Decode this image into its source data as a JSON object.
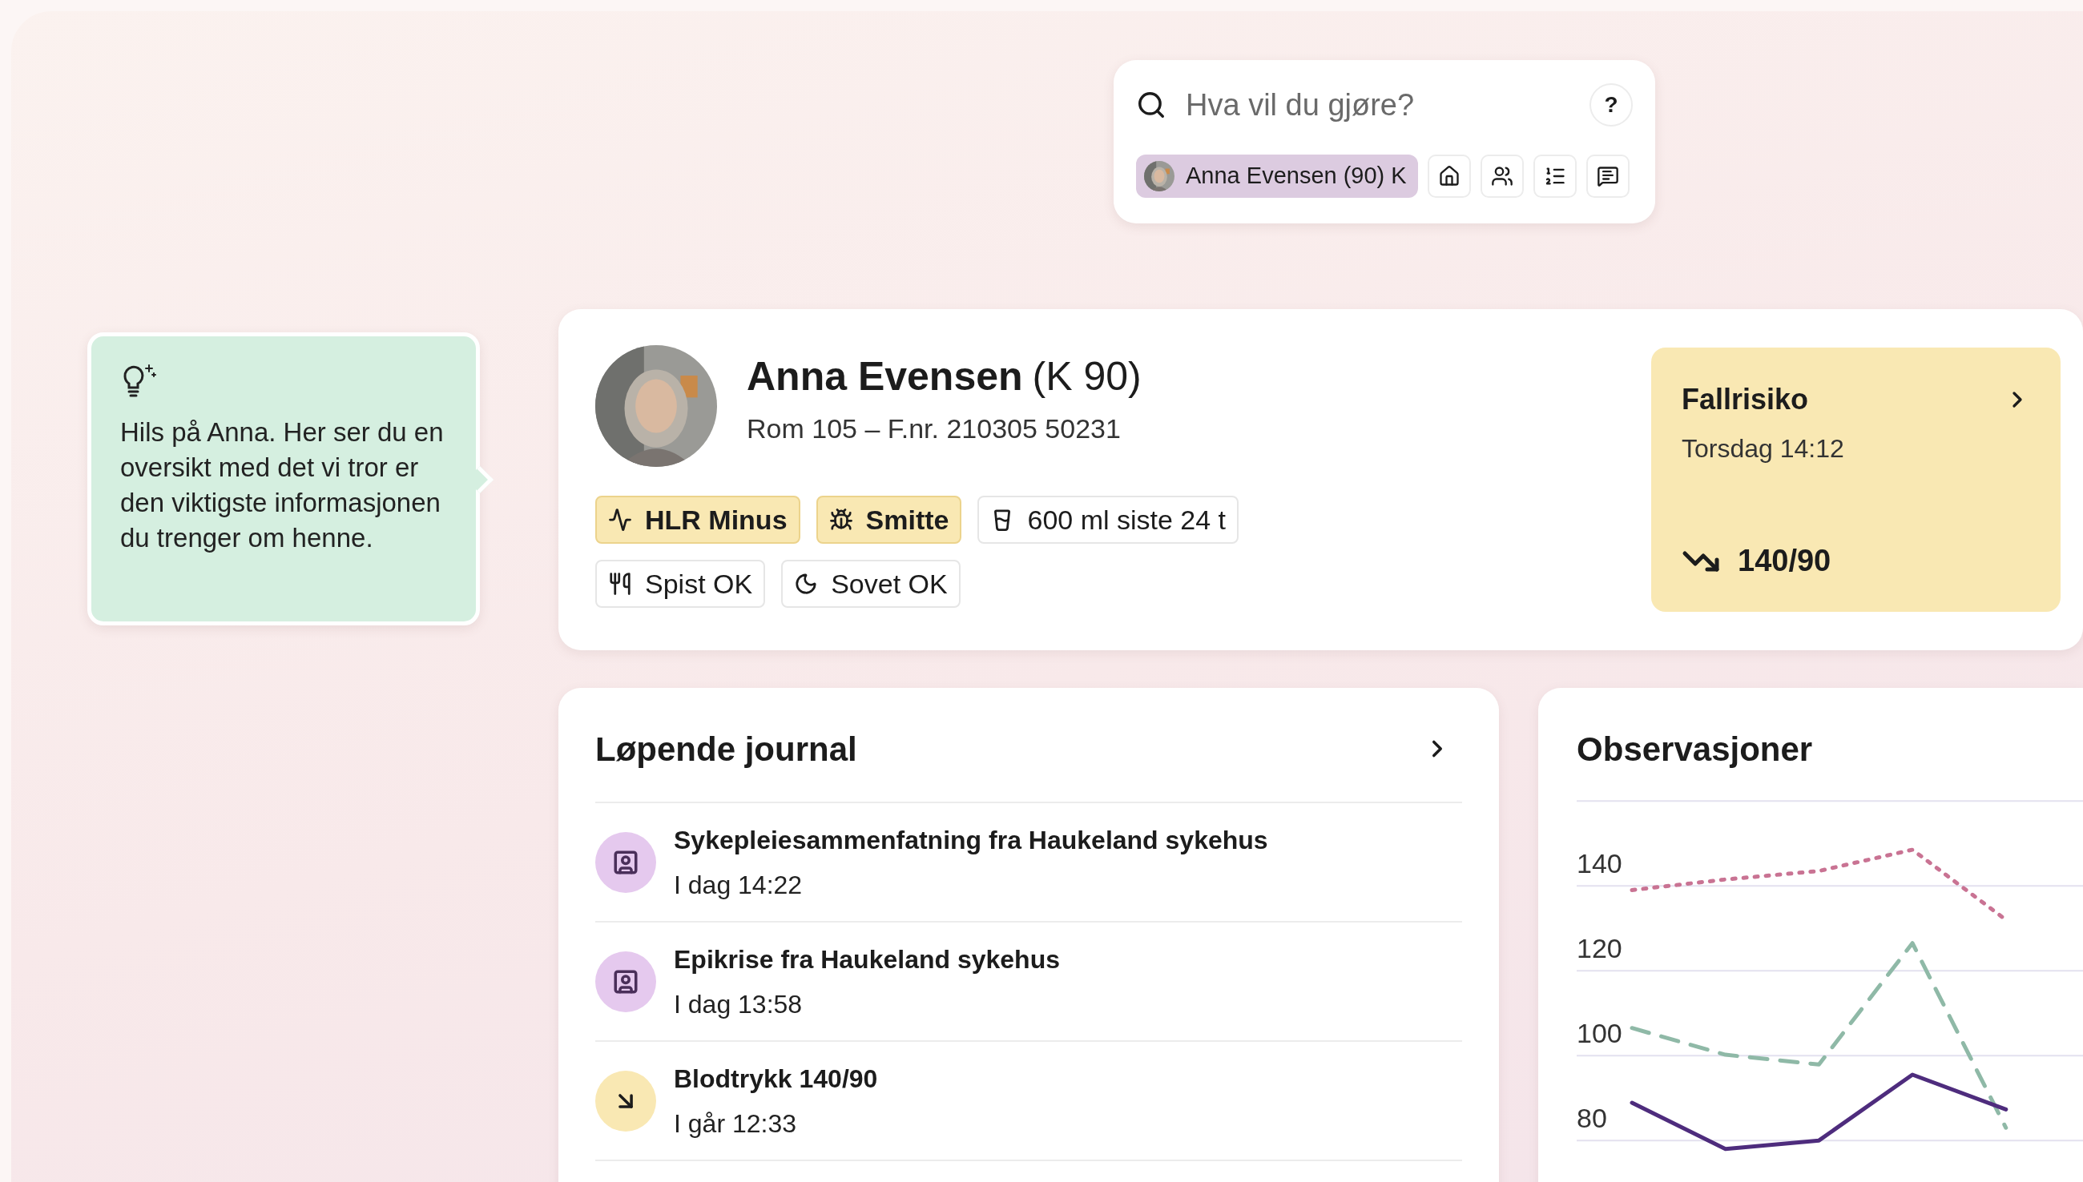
{
  "search": {
    "placeholder": "Hva vil du gjøre?",
    "help": "?"
  },
  "patient_chip": {
    "label": "Anna Evensen (90) K",
    "selected": true
  },
  "tip": {
    "text": "Hils på Anna. Her ser du en oversikt med det vi tror er den viktigste informasjonen du trenger om henne."
  },
  "patient": {
    "name": "Anna Evensen",
    "age_sex": "(K 90)",
    "subtitle": "Rom 105 – F.nr. 210305 50231",
    "tag_rows": [
      [
        {
          "label": "HLR Minus",
          "highlighted": true
        },
        {
          "label": "Smitte",
          "highlighted": true
        },
        {
          "label": "600 ml siste 24 t",
          "highlighted": false
        }
      ],
      [
        {
          "label": "Spist OK",
          "highlighted": false
        },
        {
          "label": "Sovet OK",
          "highlighted": false
        }
      ]
    ]
  },
  "alert": {
    "title": "Fallrisiko",
    "time": "Torsdag 14:12",
    "value": "140/90"
  },
  "journal": {
    "title": "Løpende journal",
    "entries": [
      {
        "title": "Sykepleiesammenfatning fra Haukeland sykehus",
        "time": "I dag 14:22",
        "kind": "document"
      },
      {
        "title": "Epikrise fra Haukeland sykehus",
        "time": "I dag 13:58",
        "kind": "document"
      },
      {
        "title": "Blodtrykk 140/90",
        "time": "I går 12:33",
        "kind": "measurement"
      }
    ]
  },
  "observations": {
    "title": "Observasjoner",
    "chart_data": {
      "type": "line",
      "categories": [
        null,
        null,
        null,
        null,
        null
      ],
      "ylim": [
        58.9,
        187.2
      ],
      "yticks": [
        80,
        100,
        120,
        140
      ],
      "grid": true,
      "series": [
        {
          "color": "#c97393",
          "line_style": "dotted",
          "values": [
            139,
            141.5,
            143.5,
            148.5,
            132
          ]
        },
        {
          "color": "#8fb9a7",
          "line_style": "dashed",
          "values": [
            106.5,
            100.2,
            97.9,
            126.5,
            83
          ]
        },
        {
          "color": "#4e2c7d",
          "line_style": "solid",
          "values": [
            88.9,
            78,
            80,
            95.5,
            87.3
          ]
        }
      ]
    }
  }
}
